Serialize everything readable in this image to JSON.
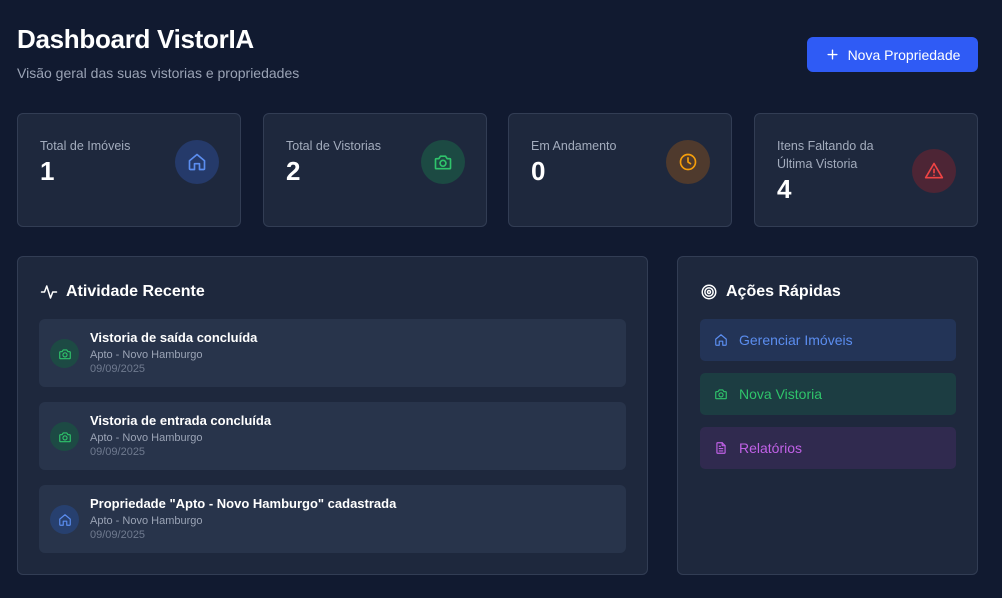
{
  "header": {
    "title": "Dashboard VistorIA",
    "subtitle": "Visão geral das suas vistorias e propriedades",
    "new_property_label": "Nova Propriedade"
  },
  "stats": [
    {
      "label": "Total de Imóveis",
      "value": "1",
      "icon": "home-icon",
      "color": "#5b8def"
    },
    {
      "label": "Total de Vistorias",
      "value": "2",
      "icon": "camera-icon",
      "color": "#2fc46b"
    },
    {
      "label": "Em Andamento",
      "value": "0",
      "icon": "clock-icon",
      "color": "#f59e0b"
    },
    {
      "label": "Itens Faltando da Última Vistoria",
      "value": "4",
      "icon": "alert-triangle-icon",
      "color": "#ef4444"
    }
  ],
  "activity": {
    "title": "Atividade Recente",
    "items": [
      {
        "title": "Vistoria de saída concluída",
        "subtitle": "Apto - Novo Hamburgo",
        "date": "09/09/2025",
        "icon": "camera-icon"
      },
      {
        "title": "Vistoria de entrada concluída",
        "subtitle": "Apto - Novo Hamburgo",
        "date": "09/09/2025",
        "icon": "camera-icon"
      },
      {
        "title": "Propriedade \"Apto - Novo Hamburgo\" cadastrada",
        "subtitle": "Apto - Novo Hamburgo",
        "date": "09/09/2025",
        "icon": "home-icon"
      }
    ]
  },
  "quick_actions": {
    "title": "Ações Rápidas",
    "items": [
      {
        "label": "Gerenciar Imóveis",
        "icon": "home-icon",
        "color": "#5b8def"
      },
      {
        "label": "Nova Vistoria",
        "icon": "camera-icon",
        "color": "#2fc46b"
      },
      {
        "label": "Relatórios",
        "icon": "file-text-icon",
        "color": "#c061e6"
      }
    ]
  },
  "colors": {
    "background": "#111a30",
    "card": "#1e283d",
    "accent": "#2f5bf5"
  }
}
